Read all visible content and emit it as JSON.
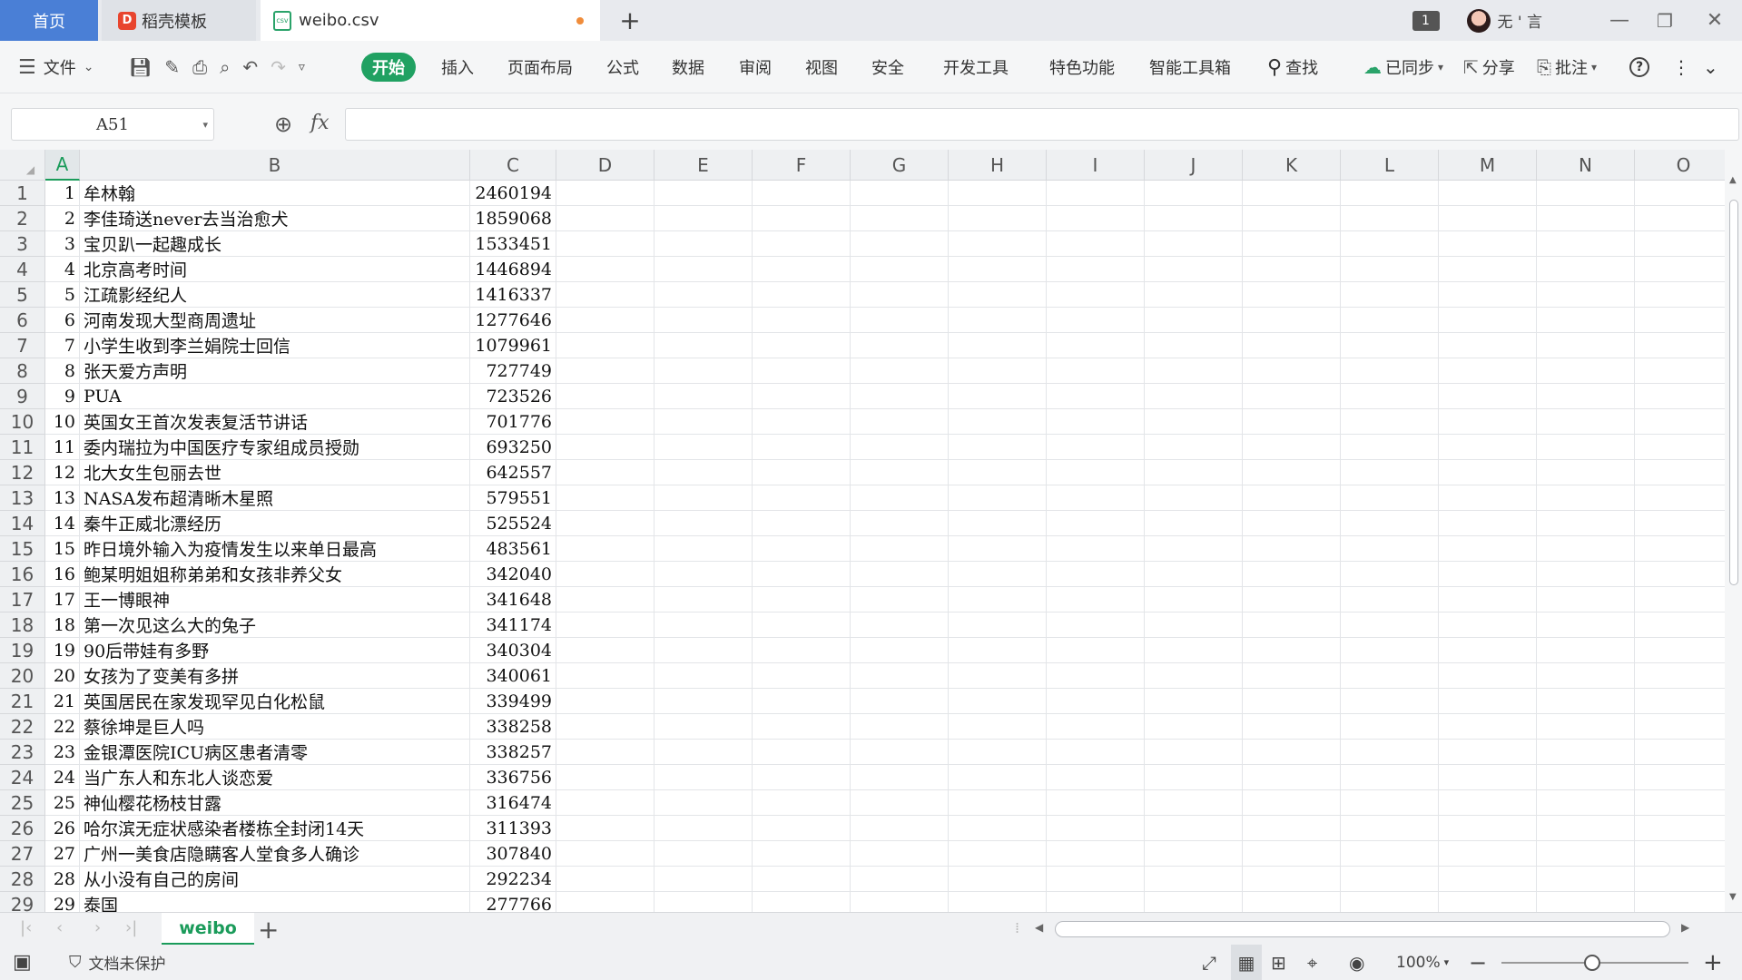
{
  "tabs": {
    "home": "首页",
    "template": "稻壳模板",
    "file": "weibo.csv",
    "add": "+"
  },
  "window": {
    "badge": "1",
    "user": "无 ' 言"
  },
  "ribbon": {
    "menu": "文件",
    "items": [
      "开始",
      "插入",
      "页面布局",
      "公式",
      "数据",
      "审阅",
      "视图",
      "安全",
      "开发工具",
      "特色功能",
      "智能工具箱"
    ],
    "search": "查找",
    "sync": "已同步",
    "share": "分享",
    "comment": "批注"
  },
  "formula_bar": {
    "cell_ref": "A51",
    "fx": "fx",
    "value": ""
  },
  "grid": {
    "columns": [
      "A",
      "B",
      "C",
      "D",
      "E",
      "F",
      "G",
      "H",
      "I",
      "J",
      "K",
      "L",
      "M",
      "N",
      "O"
    ],
    "rows": [
      {
        "n": "1",
        "a": "1",
        "b": "牟林翰",
        "c": "2460194"
      },
      {
        "n": "2",
        "a": "2",
        "b": "李佳琦送never去当治愈犬",
        "c": "1859068"
      },
      {
        "n": "3",
        "a": "3",
        "b": "宝贝趴一起趣成长",
        "c": "1533451"
      },
      {
        "n": "4",
        "a": "4",
        "b": "北京高考时间",
        "c": "1446894"
      },
      {
        "n": "5",
        "a": "5",
        "b": "江疏影经纪人",
        "c": "1416337"
      },
      {
        "n": "6",
        "a": "6",
        "b": "河南发现大型商周遗址",
        "c": "1277646"
      },
      {
        "n": "7",
        "a": "7",
        "b": "小学生收到李兰娟院士回信",
        "c": "1079961"
      },
      {
        "n": "8",
        "a": "8",
        "b": "张天爱方声明",
        "c": "727749"
      },
      {
        "n": "9",
        "a": "9",
        "b": "PUA",
        "c": "723526"
      },
      {
        "n": "10",
        "a": "10",
        "b": "英国女王首次发表复活节讲话",
        "c": "701776"
      },
      {
        "n": "11",
        "a": "11",
        "b": "委内瑞拉为中国医疗专家组成员授勋",
        "c": "693250"
      },
      {
        "n": "12",
        "a": "12",
        "b": "北大女生包丽去世",
        "c": "642557"
      },
      {
        "n": "13",
        "a": "13",
        "b": "NASA发布超清晰木星照",
        "c": "579551"
      },
      {
        "n": "14",
        "a": "14",
        "b": "秦牛正威北漂经历",
        "c": "525524"
      },
      {
        "n": "15",
        "a": "15",
        "b": "昨日境外输入为疫情发生以来单日最高",
        "c": "483561"
      },
      {
        "n": "16",
        "a": "16",
        "b": "鲍某明姐姐称弟弟和女孩非养父女",
        "c": "342040"
      },
      {
        "n": "17",
        "a": "17",
        "b": "王一博眼神",
        "c": "341648"
      },
      {
        "n": "18",
        "a": "18",
        "b": "第一次见这么大的兔子",
        "c": "341174"
      },
      {
        "n": "19",
        "a": "19",
        "b": "90后带娃有多野",
        "c": "340304"
      },
      {
        "n": "20",
        "a": "20",
        "b": "女孩为了变美有多拼",
        "c": "340061"
      },
      {
        "n": "21",
        "a": "21",
        "b": "英国居民在家发现罕见白化松鼠",
        "c": "339499"
      },
      {
        "n": "22",
        "a": "22",
        "b": "蔡徐坤是巨人吗",
        "c": "338258"
      },
      {
        "n": "23",
        "a": "23",
        "b": "金银潭医院ICU病区患者清零",
        "c": "338257"
      },
      {
        "n": "24",
        "a": "24",
        "b": "当广东人和东北人谈恋爱",
        "c": "336756"
      },
      {
        "n": "25",
        "a": "25",
        "b": "神仙樱花杨枝甘露",
        "c": "316474"
      },
      {
        "n": "26",
        "a": "26",
        "b": "哈尔滨无症状感染者楼栋全封闭14天",
        "c": "311393"
      },
      {
        "n": "27",
        "a": "27",
        "b": "广州一美食店隐瞒客人堂食多人确诊",
        "c": "307840"
      },
      {
        "n": "28",
        "a": "28",
        "b": "从小没有自己的房间",
        "c": "292234"
      },
      {
        "n": "29",
        "a": "29",
        "b": "泰国",
        "c": "277766"
      }
    ]
  },
  "sheetbar": {
    "sheet": "weibo",
    "add": "+"
  },
  "status": {
    "protect": "文档未保护",
    "zoom": "100%"
  },
  "colors": {
    "accent_green": "#20a162",
    "home_tab": "#4a7fd6",
    "header_bg": "#eef0f2"
  }
}
